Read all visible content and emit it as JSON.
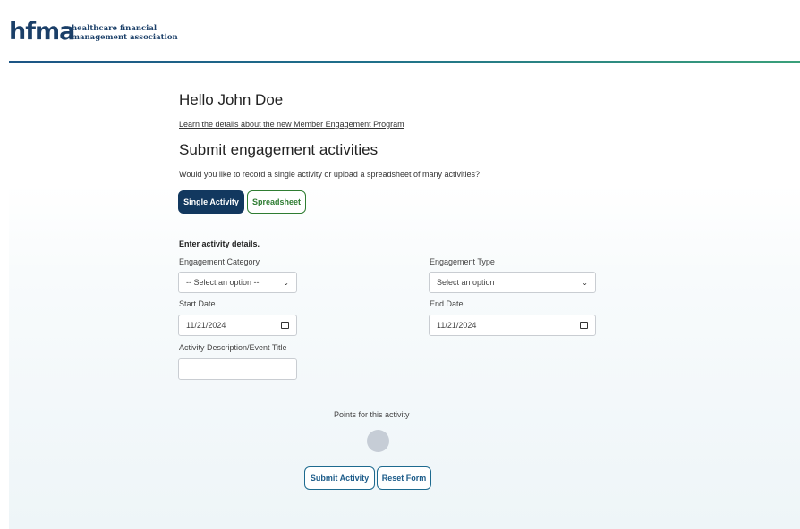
{
  "header": {
    "logo_mark": "hfma",
    "logo_tm": "™",
    "logo_line1": "healthcare financial",
    "logo_line2": "management association"
  },
  "main": {
    "greeting": "Hello John Doe",
    "learn_link": "Learn the details about the new Member Engagement Program",
    "section_title": "Submit engagement activities",
    "question": "Would you like to record a single activity or upload a spreadsheet of many activities?",
    "toggle": {
      "single_label": "Single Activity",
      "spreadsheet_label": "Spreadsheet",
      "selected": "Single Activity"
    },
    "details_label": "Enter activity details.",
    "fields": {
      "category_label": "Engagement Category",
      "category_value": "-- Select an option --",
      "type_label": "Engagement Type",
      "type_value": "Select an option",
      "start_label": "Start Date",
      "start_value": "11/21/2024",
      "end_label": "End Date",
      "end_value": "11/21/2024",
      "description_label": "Activity Description/Event Title",
      "description_value": ""
    },
    "points_label": "Points for this activity",
    "actions": {
      "submit_label": "Submit Activity",
      "reset_label": "Reset Form"
    }
  },
  "colors": {
    "brand_navy": "#12385f",
    "brand_green": "#2f7d32",
    "action_blue": "#1d6a8f"
  }
}
